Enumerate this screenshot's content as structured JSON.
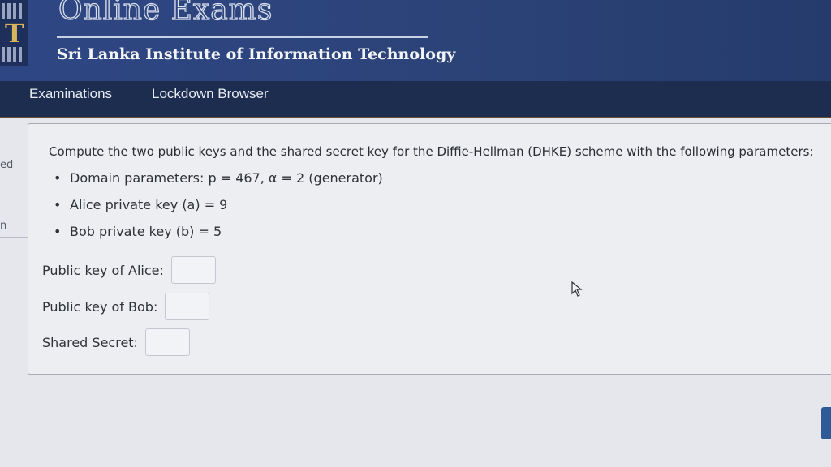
{
  "header": {
    "app_title": "Online Exams",
    "institute": "Sri Lanka Institute of Information Technology",
    "logo_letter": "T"
  },
  "nav": {
    "items": [
      {
        "label": "Examinations"
      },
      {
        "label": "Lockdown Browser"
      }
    ]
  },
  "edge_fragments": [
    "ed",
    "n"
  ],
  "question": {
    "text": "Compute the two public keys and the shared secret key for the Diffie-Hellman (DHKE) scheme with the following parameters:",
    "params": [
      "Domain parameters: p = 467, α = 2 (generator)",
      "Alice private key (a) = 9",
      "Bob private key (b) = 5"
    ],
    "fields": [
      {
        "label": "Public key of Alice:",
        "value": ""
      },
      {
        "label": "Public key of Bob:",
        "value": ""
      },
      {
        "label": "Shared Secret:",
        "value": ""
      }
    ]
  },
  "colors": {
    "header_bg": "#2e4684",
    "nav_bg": "#1d2d4f",
    "accent_tab": "#2e5b98"
  }
}
